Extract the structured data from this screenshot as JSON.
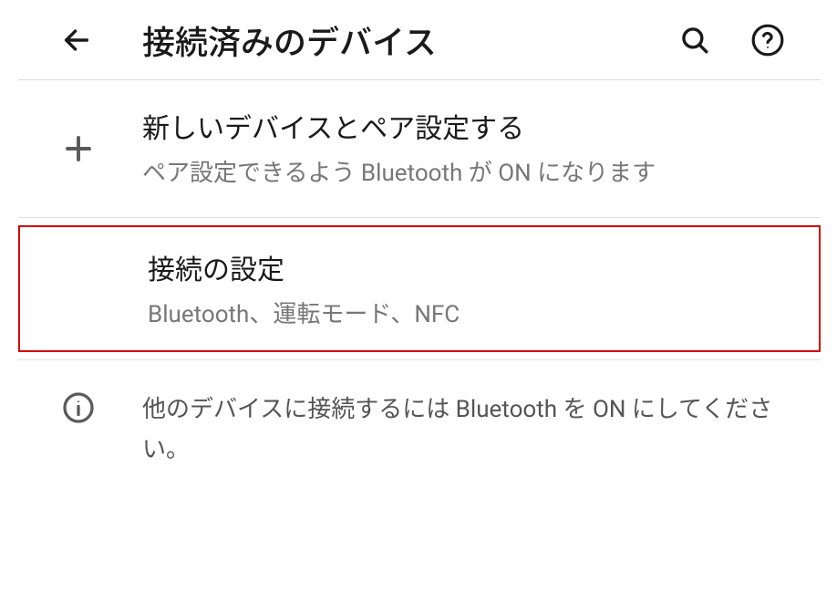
{
  "header": {
    "title": "接続済みのデバイス"
  },
  "items": {
    "pair": {
      "title": "新しいデバイスとペア設定する",
      "subtitle": "ペア設定できるよう Bluetooth が ON になります"
    },
    "prefs": {
      "title": "接続の設定",
      "subtitle": "Bluetooth、運転モード、NFC"
    },
    "info": {
      "text": "他のデバイスに接続するには Bluetooth を ON にしてください。"
    }
  }
}
